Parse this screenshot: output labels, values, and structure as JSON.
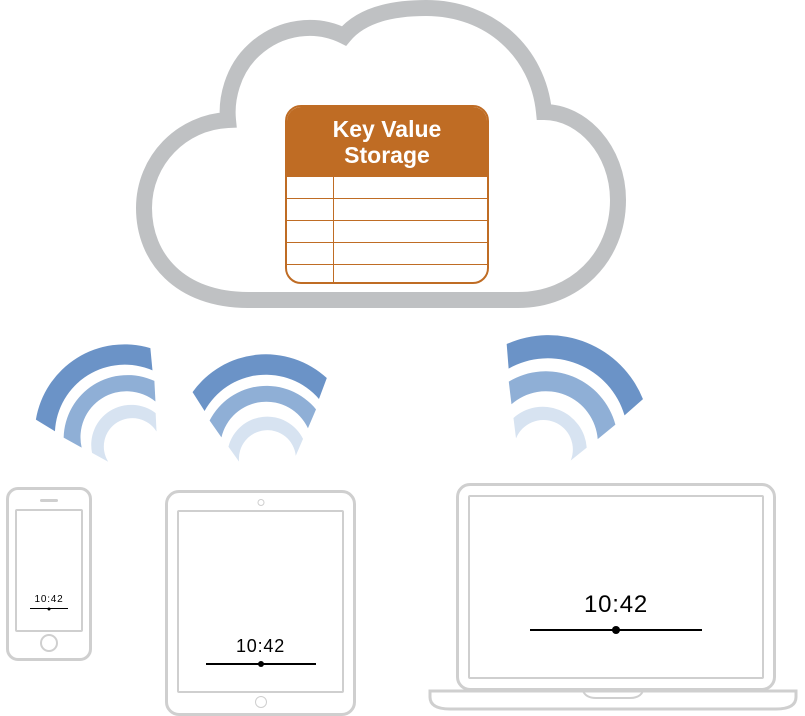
{
  "cloud": {
    "storage_title_line1": "Key Value",
    "storage_title_line2": "Storage"
  },
  "devices": {
    "phone_time": "10:42",
    "tablet_time": "10:42",
    "laptop_time": "10:42"
  },
  "colors": {
    "cloud_outline": "#BFC1C3",
    "storage": "#BF6C24",
    "wifi_dark": "#6B93C7",
    "wifi_mid": "#8FAFD6",
    "wifi_light": "#D7E3F1"
  }
}
